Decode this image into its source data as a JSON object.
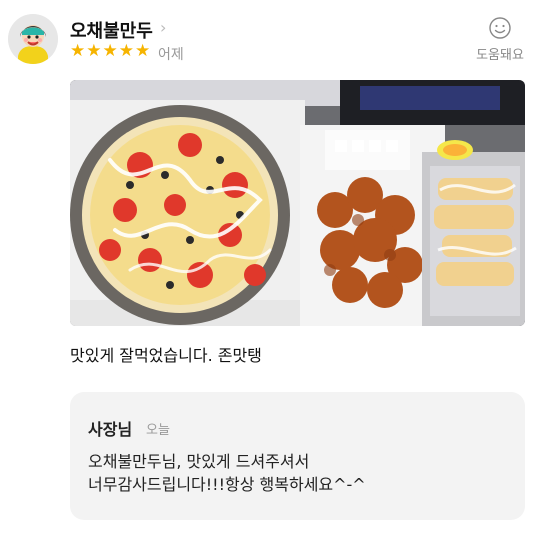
{
  "review": {
    "user_name": "오채불만두",
    "chevron": "›",
    "rating": 5,
    "stars": [
      "★",
      "★",
      "★",
      "★",
      "★"
    ],
    "date": "어제",
    "helpful_label": "도움돼요",
    "helpful_icon": "smiley-icon",
    "text": "맛있게 잘먹었습니다. 존맛탱"
  },
  "reply": {
    "title": "사장님",
    "date": "오늘",
    "lines": [
      "오채불만두님, 맛있게 드셔주셔서",
      "너무감사드립니다!!!항상 행복하세요^-^"
    ]
  },
  "colors": {
    "star": "#f6b400",
    "reply_bg": "#f3f3f3"
  }
}
